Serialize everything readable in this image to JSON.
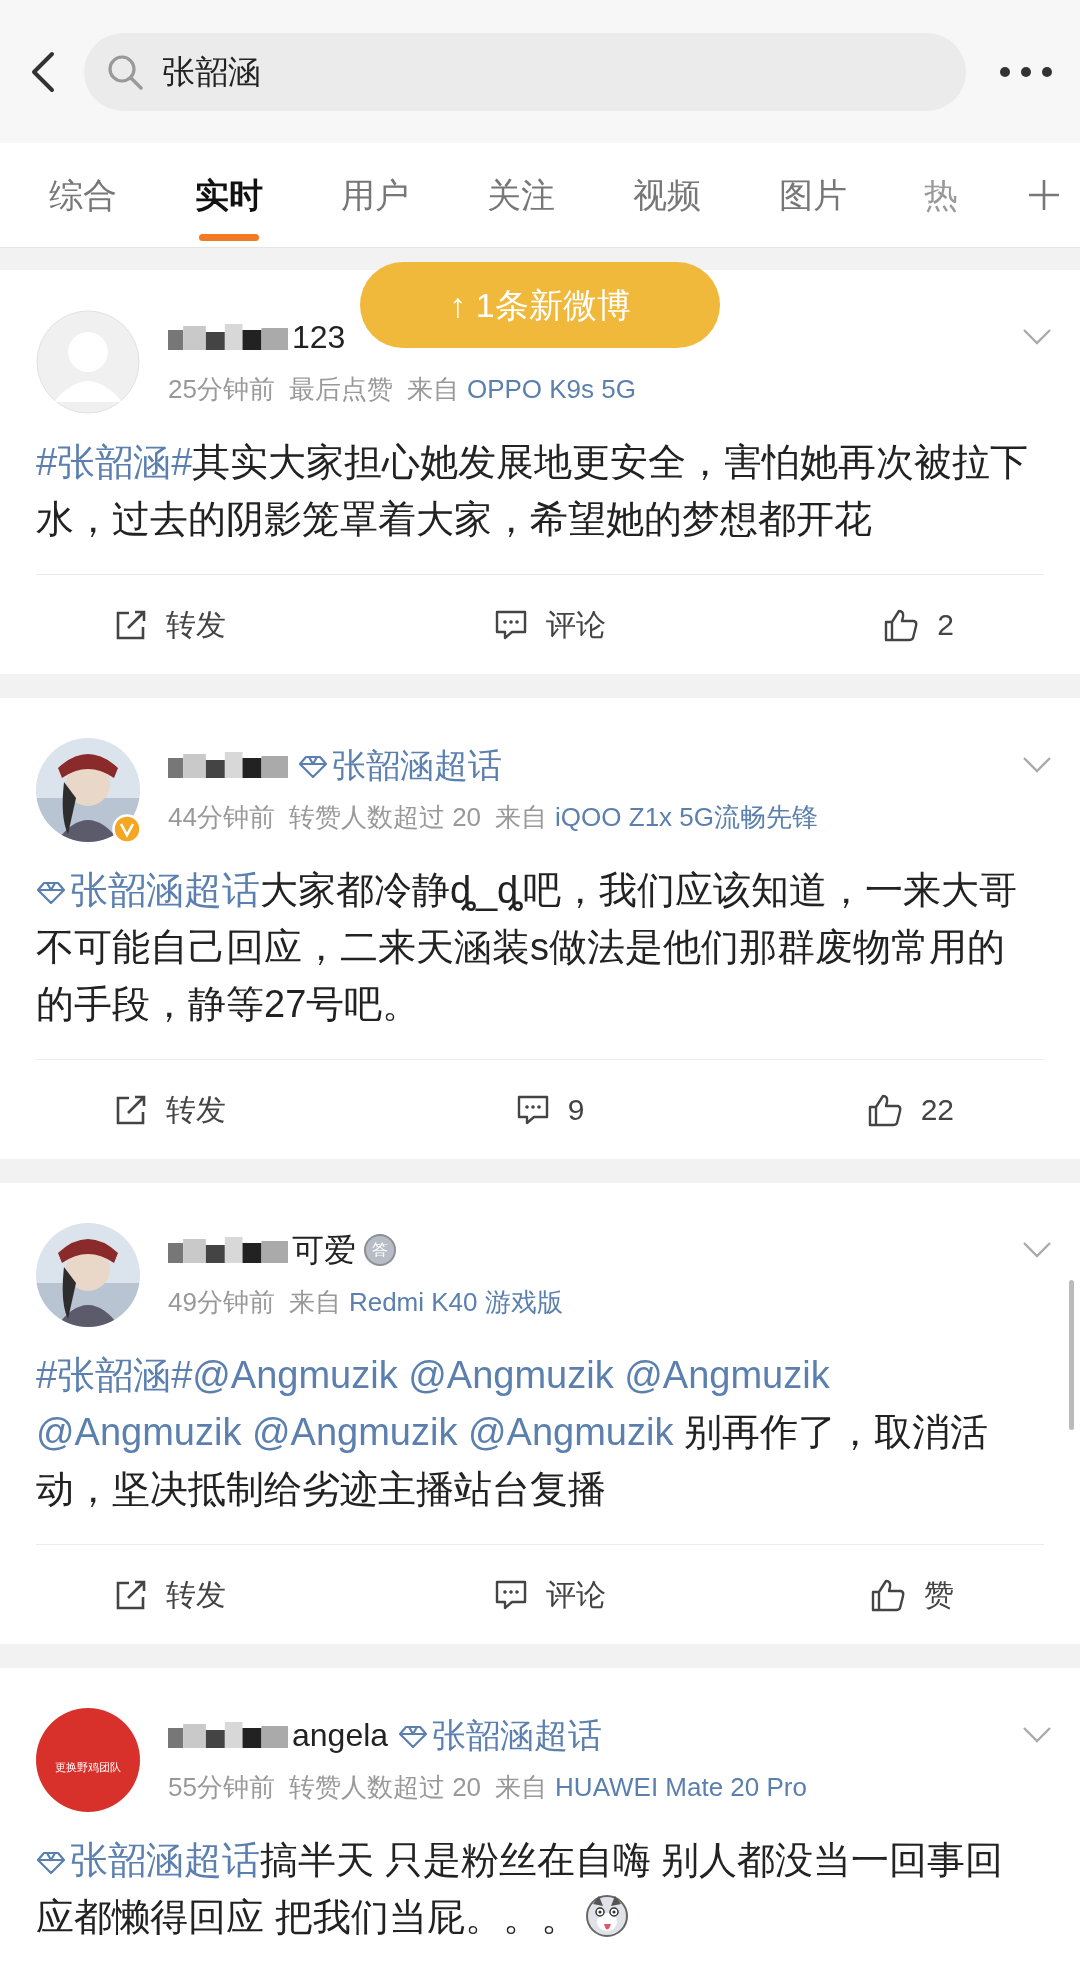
{
  "search": {
    "value": "张韶涵"
  },
  "tabs": [
    {
      "label": "综合",
      "selected": false
    },
    {
      "label": "实时",
      "selected": true
    },
    {
      "label": "用户",
      "selected": false
    },
    {
      "label": "关注",
      "selected": false
    },
    {
      "label": "视频",
      "selected": false
    },
    {
      "label": "图片",
      "selected": false
    },
    {
      "label": "热",
      "selected": false
    }
  ],
  "new_posts_banner": "↑ 1条新微博",
  "posts": [
    {
      "avatar": {
        "kind": "placeholder",
        "verified": false
      },
      "name_fragment": "123",
      "time": "25分钟前",
      "note": "最后点赞",
      "source_prefix": "来自",
      "source": "OPPO K9s 5G",
      "body": [
        {
          "kind": "hashtag",
          "text": "#张韶涵#"
        },
        {
          "kind": "text",
          "text": "其实大家担心她发展地更安全，害怕她再次被拉下水，过去的阴影笼罩着大家，希望她的梦想都开花"
        }
      ],
      "repost": "转发",
      "comment": "评论",
      "like": "2"
    },
    {
      "avatar": {
        "kind": "picture",
        "verified": true
      },
      "super_topic": "张韶涵超话",
      "time": "44分钟前",
      "note": "转赞人数超过 20",
      "source_prefix": "来自",
      "source": "iQOO Z1x 5G流畅先锋",
      "body": [
        {
          "kind": "topic",
          "text": "张韶涵超话"
        },
        {
          "kind": "text",
          "text": "大家都冷静ȡ_ȡ吧，我们应该知道，一来大哥不可能自己回应，二来天涵装s做法是他们那群废物常用的的手段，静等27号吧。"
        }
      ],
      "repost": "转发",
      "comment": "9",
      "like": "22"
    },
    {
      "avatar": {
        "kind": "picture",
        "verified": false
      },
      "name_fragment": "可爱",
      "name_badge": "答",
      "time": "49分钟前",
      "source_prefix": "来自",
      "source": "Redmi K40 游戏版",
      "body": [
        {
          "kind": "hashtag",
          "text": "#张韶涵#"
        },
        {
          "kind": "mention",
          "text": "@Angmuzik"
        },
        {
          "kind": "mention",
          "text": "@Angmuzik"
        },
        {
          "kind": "mention",
          "text": "@Angmuzik"
        },
        {
          "kind": "mention",
          "text": "@Angmuzik"
        },
        {
          "kind": "mention",
          "text": "@Angmuzik"
        },
        {
          "kind": "mention",
          "text": "@Angmuzik"
        },
        {
          "kind": "text",
          "text": " 别再作了，取消活动，坚决抵制给劣迹主播站台复播"
        }
      ],
      "repost": "转发",
      "comment": "评论",
      "like": "赞"
    },
    {
      "avatar": {
        "kind": "red",
        "verified": false,
        "text": "更换野鸡团队"
      },
      "name_fragment": "angela",
      "super_topic": "张韶涵超话",
      "time": "55分钟前",
      "note": "转赞人数超过 20",
      "source_prefix": "来自",
      "source": "HUAWEI Mate 20 Pro",
      "body": [
        {
          "kind": "topic",
          "text": "张韶涵超话"
        },
        {
          "kind": "text",
          "text": "搞半天 只是粉丝在自嗨 别人都没当一回事回应都懒得回应 把我们当屁。。。"
        },
        {
          "kind": "emoji"
        }
      ]
    }
  ]
}
